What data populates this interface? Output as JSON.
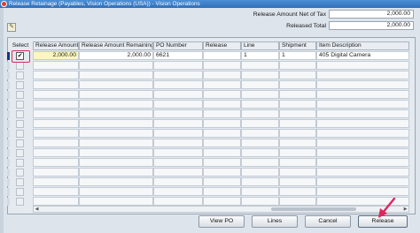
{
  "window": {
    "title": "Release Retainage (Payables, Vision Operations (USA)) - Vision Operations"
  },
  "totals": {
    "net_of_tax_label": "Release Amount Net of Tax",
    "net_of_tax_value": "2,000.00",
    "released_total_label": "Released Total",
    "released_total_value": "2,000.00"
  },
  "grid": {
    "select_header": "Select",
    "columns": [
      "Release Amount",
      "Release Amount Remaining",
      "PO Number",
      "Release",
      "Line",
      "Shipment",
      "Item Description"
    ],
    "rows": [
      {
        "selected": true,
        "checkmark": "✔",
        "cells": [
          "2,000.00",
          "2,000.00",
          "6621",
          "",
          "1",
          "1",
          "405 Digital Camera"
        ]
      }
    ]
  },
  "buttons": {
    "view_po": "View PO",
    "lines": "Lines",
    "cancel": "Cancel",
    "release": "Release"
  },
  "colors": {
    "titlebar": "#3a7cc8",
    "selected_row_indicator": "#1f2f86",
    "annotation": "#e0245e",
    "highlight_cell": "#fdf6c2"
  }
}
